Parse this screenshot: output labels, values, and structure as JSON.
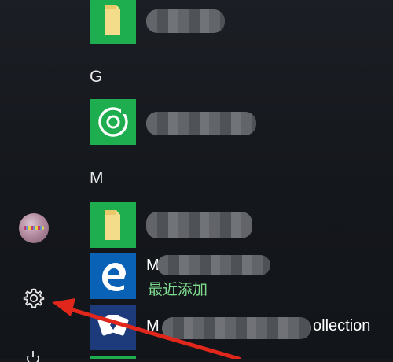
{
  "start_menu": {
    "rail": {
      "avatar_icon": "user-avatar",
      "settings_icon": "gear-icon",
      "power_icon": "power-icon"
    },
    "sections": [
      {
        "letter": "G"
      },
      {
        "letter": "M"
      }
    ],
    "apps": [
      {
        "icon": "folder-icon",
        "tile_color": "#1fae4f",
        "label": ""
      },
      {
        "icon": "groove-music-icon",
        "tile_color": "#1fae4f",
        "label": ""
      },
      {
        "icon": "folder-icon",
        "tile_color": "#1fae4f",
        "label": ""
      },
      {
        "icon": "edge-icon",
        "tile_color": "#0a62b6",
        "label": "M",
        "badge": "最近添加"
      },
      {
        "icon": "solitaire-cards-icon",
        "tile_color": "#1d3b7a",
        "label": "M",
        "suffix": "ollection"
      }
    ],
    "annotation": {
      "type": "red-arrow",
      "points_to": "settings",
      "color": "#e1261c"
    }
  }
}
